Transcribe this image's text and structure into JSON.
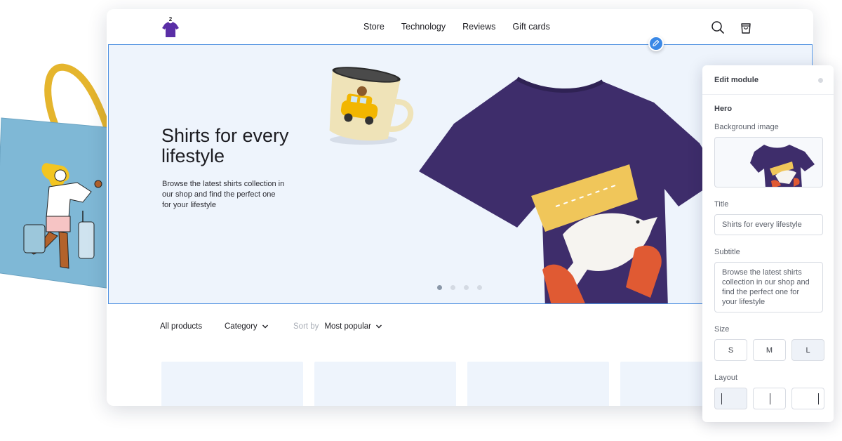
{
  "header": {
    "logo_badge": "2",
    "nav": [
      "Store",
      "Technology",
      "Reviews",
      "Gift cards"
    ]
  },
  "hero": {
    "title": "Shirts for every lifestyle",
    "subtitle": "Browse the latest shirts collection in our shop and find the perfect one for your lifestyle",
    "slides_total": 4,
    "active_slide": 1
  },
  "filters": {
    "all_products": "All products",
    "category": "Category",
    "sort_label": "Sort by",
    "sort_value": "Most popular"
  },
  "panel": {
    "title": "Edit module",
    "section": "Hero",
    "background_label": "Background image",
    "title_label": "Title",
    "title_value": "Shirts for every lifestyle",
    "subtitle_label": "Subtitle",
    "subtitle_value": "Browse the latest shirts collection in our shop and find the perfect one for your lifestyle",
    "size_label": "Size",
    "sizes": [
      "S",
      "M",
      "L"
    ],
    "selected_size": "L",
    "layout_label": "Layout",
    "selected_layout": 1
  },
  "colors": {
    "accent": "#3a88e6",
    "hero_bg": "#eef4fc",
    "shirt": "#3e2d6b",
    "tote": "#7fb8d6",
    "handle": "#e5b52d"
  },
  "icons": [
    "search-icon",
    "cart-icon",
    "pencil-icon",
    "chevron-down-icon"
  ]
}
